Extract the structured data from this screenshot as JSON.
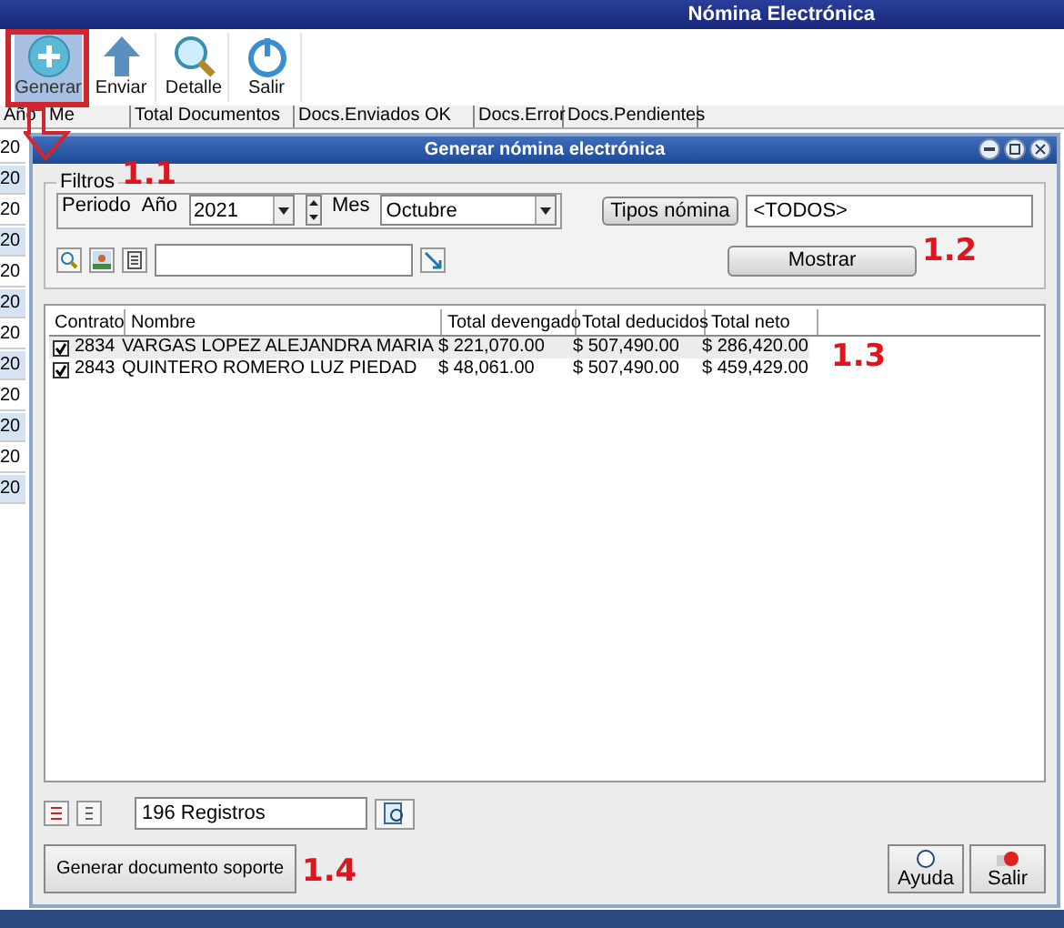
{
  "window": {
    "title": "Nómina Electrónica"
  },
  "toolbar": [
    {
      "label": "Generar",
      "selected": true
    },
    {
      "label": "Enviar",
      "selected": false
    },
    {
      "label": "Detalle",
      "selected": false
    },
    {
      "label": "Salir",
      "selected": false
    }
  ],
  "background_table": {
    "columns": [
      "Año",
      "Me",
      "Total Documentos",
      "Docs.Enviados OK",
      "Docs.Error",
      "Docs.Pendientes"
    ],
    "rows": [
      "20",
      "20",
      "20",
      "20",
      "20",
      "20",
      "20",
      "20",
      "20",
      "20",
      "20",
      "20"
    ]
  },
  "dialog": {
    "title": "Generar nómina electrónica",
    "filters": {
      "legend": "Filtros",
      "period_label": "Periodo",
      "year_label": "Año",
      "year": "2021",
      "month_label": "Mes",
      "month": "Octubre",
      "types_button": "Tipos nómina",
      "types_value": "<TODOS>",
      "show_button": "Mostrar"
    },
    "grid": {
      "columns": [
        "Contrato",
        "Nombre",
        "Total devengado",
        "Total deducidos",
        "Total neto"
      ],
      "rows": [
        {
          "checked": true,
          "cells": [
            "2834",
            "VARGAS LOPEZ ALEJANDRA MARIA",
            "$ 221,070.00",
            "$ 507,490.00",
            "$ 286,420.00"
          ],
          "selected": true
        },
        {
          "checked": true,
          "cells": [
            "2843",
            "QUINTERO ROMERO LUZ PIEDAD",
            "$ 48,061.00",
            "$ 507,490.00",
            "$ 459,429.00"
          ],
          "selected": false
        }
      ]
    },
    "records": "196 Registros",
    "support_button": "Generar documento soporte",
    "help_button": "Ayuda",
    "exit_button": "Salir"
  },
  "annotations": [
    "1.1",
    "1.2",
    "1.3",
    "1.4"
  ]
}
